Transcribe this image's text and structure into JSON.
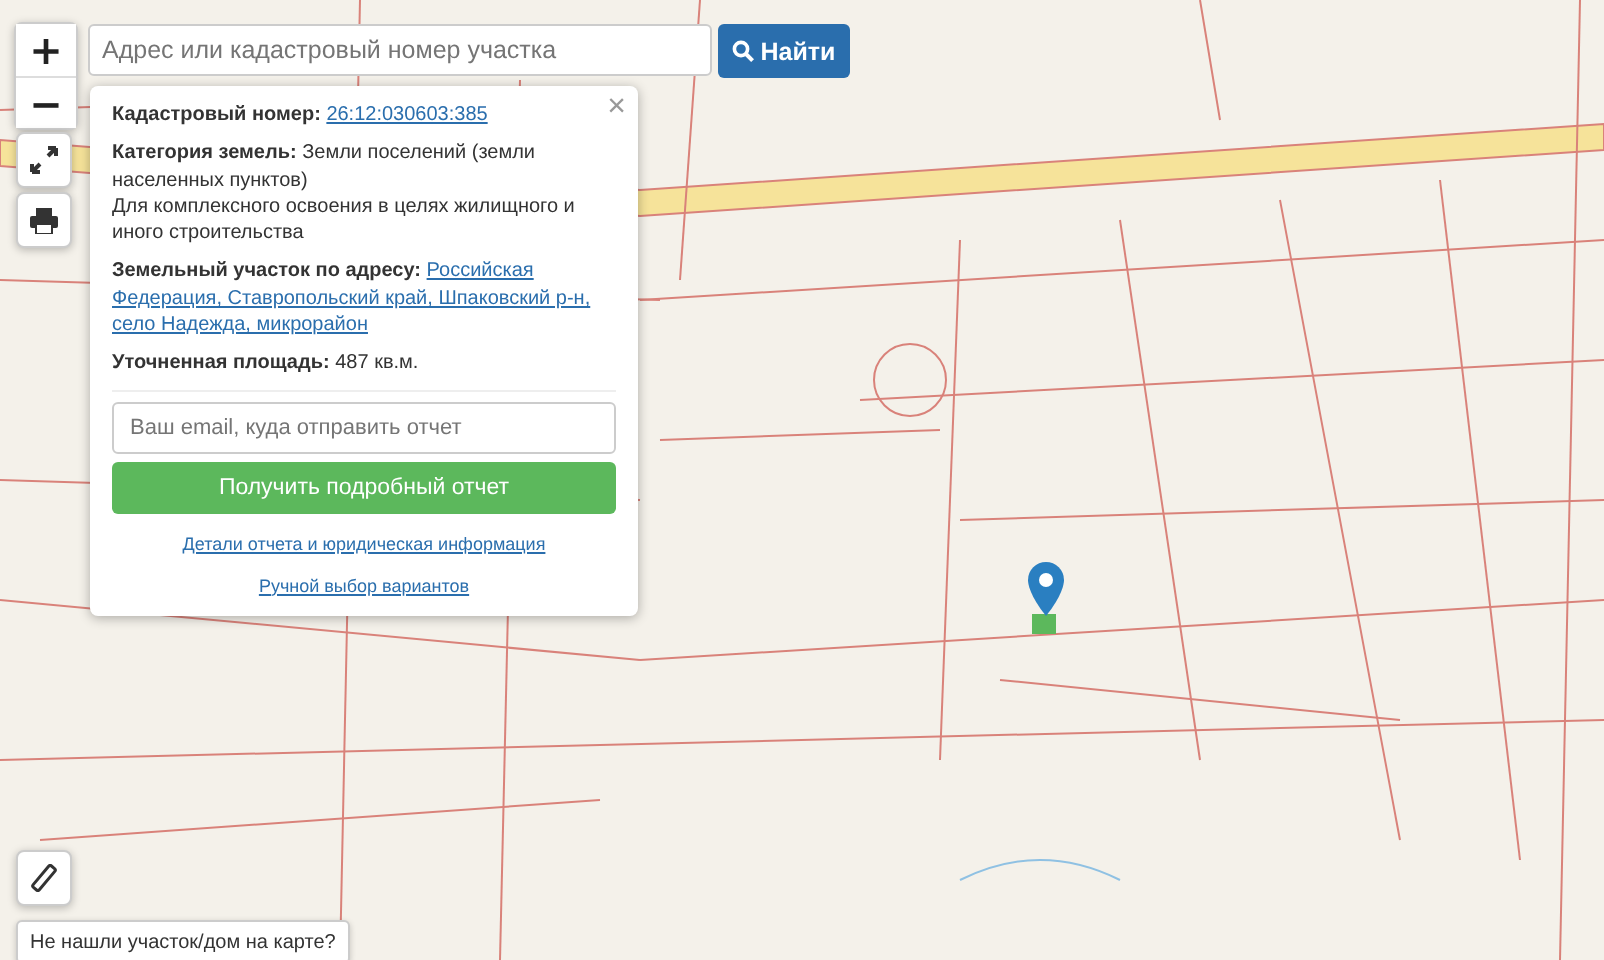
{
  "search": {
    "placeholder": "Адрес или кадастровый номер участка",
    "button": "Найти"
  },
  "zoom_controls": [
    "+",
    "−"
  ],
  "popup": {
    "close": "×",
    "fields": [
      {
        "kind": "link",
        "label": "Кадастровый номер:",
        "value": "26:12:030603:385"
      },
      {
        "kind": "text",
        "text": "**Категория земель:** Земли поселений (земли населенных пунктов)"
      },
      {
        "kind": "note",
        "value": "Для комплексного освоения в целях жилищного и иного строительства"
      },
      {
        "kind": "address",
        "label": "Земельный участок по адресу:",
        "value": "Российская Федерация, Ставропольский край, Шпаковский р-н, село Надежда, микрорайон"
      },
      {
        "kind": "text",
        "text": "**Уточненная площадь:** 487 кв.м."
      }
    ],
    "email_placeholder": "Ваш email, куда отправить отчет",
    "submit": "Получить подробный отчет",
    "links": [
      "Детали отчета и юридическая информация",
      "Ручной выбор вариантов"
    ]
  },
  "not_found_button": "Не нашли участок/дом на карте?"
}
